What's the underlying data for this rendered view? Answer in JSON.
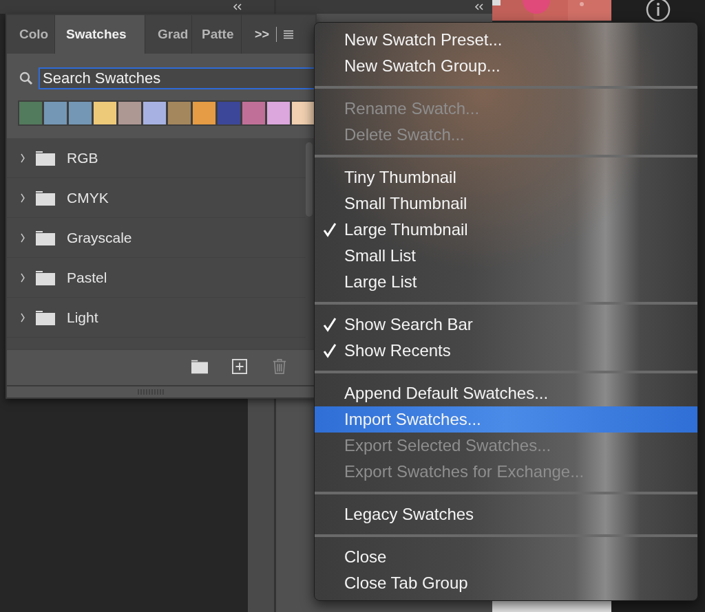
{
  "panel": {
    "tabs": [
      {
        "label": "Colo",
        "selected": false
      },
      {
        "label": "Swatches",
        "selected": true
      },
      {
        "label": "Grad",
        "selected": false
      },
      {
        "label": "Patte",
        "selected": false
      }
    ],
    "overflow_label": ">>",
    "search": {
      "placeholder": "Search Swatches"
    },
    "recent_swatches": [
      {
        "color": "#527a5c"
      },
      {
        "color": "#7497b5"
      },
      {
        "color": "#7497b5"
      },
      {
        "color": "#edc97a"
      },
      {
        "color": "#ae9894"
      },
      {
        "color": "#a8b2e2"
      },
      {
        "color": "#a5875e"
      },
      {
        "color": "#e59c44"
      },
      {
        "color": "#3c4799"
      },
      {
        "color": "#c07098"
      },
      {
        "color": "#dba7dc"
      },
      {
        "color": "#f0d0b0"
      }
    ],
    "groups": [
      {
        "name": "RGB",
        "expanded": false
      },
      {
        "name": "CMYK",
        "expanded": false
      },
      {
        "name": "Grayscale",
        "expanded": false
      },
      {
        "name": "Pastel",
        "expanded": false
      },
      {
        "name": "Light",
        "expanded": false
      }
    ]
  },
  "menu": {
    "sections": [
      {
        "items": [
          {
            "label": "New Swatch Preset...",
            "disabled": false,
            "checked": false,
            "selected": false
          },
          {
            "label": "New Swatch Group...",
            "disabled": false,
            "checked": false,
            "selected": false
          }
        ]
      },
      {
        "items": [
          {
            "label": "Rename Swatch...",
            "disabled": true,
            "checked": false,
            "selected": false
          },
          {
            "label": "Delete Swatch...",
            "disabled": true,
            "checked": false,
            "selected": false
          }
        ]
      },
      {
        "items": [
          {
            "label": "Tiny Thumbnail",
            "disabled": false,
            "checked": false,
            "selected": false
          },
          {
            "label": "Small Thumbnail",
            "disabled": false,
            "checked": false,
            "selected": false
          },
          {
            "label": "Large Thumbnail",
            "disabled": false,
            "checked": true,
            "selected": false
          },
          {
            "label": "Small List",
            "disabled": false,
            "checked": false,
            "selected": false
          },
          {
            "label": "Large List",
            "disabled": false,
            "checked": false,
            "selected": false
          }
        ]
      },
      {
        "items": [
          {
            "label": "Show Search Bar",
            "disabled": false,
            "checked": true,
            "selected": false
          },
          {
            "label": "Show Recents",
            "disabled": false,
            "checked": true,
            "selected": false
          }
        ]
      },
      {
        "items": [
          {
            "label": "Append Default Swatches...",
            "disabled": false,
            "checked": false,
            "selected": false
          },
          {
            "label": "Import Swatches...",
            "disabled": false,
            "checked": false,
            "selected": true
          },
          {
            "label": "Export Selected Swatches...",
            "disabled": true,
            "checked": false,
            "selected": false
          },
          {
            "label": "Export Swatches for Exchange...",
            "disabled": true,
            "checked": false,
            "selected": false
          }
        ]
      },
      {
        "items": [
          {
            "label": "Legacy Swatches",
            "disabled": false,
            "checked": false,
            "selected": false
          }
        ]
      },
      {
        "items": [
          {
            "label": "Close",
            "disabled": false,
            "checked": false,
            "selected": false
          },
          {
            "label": "Close Tab Group",
            "disabled": false,
            "checked": false,
            "selected": false
          }
        ]
      }
    ]
  }
}
